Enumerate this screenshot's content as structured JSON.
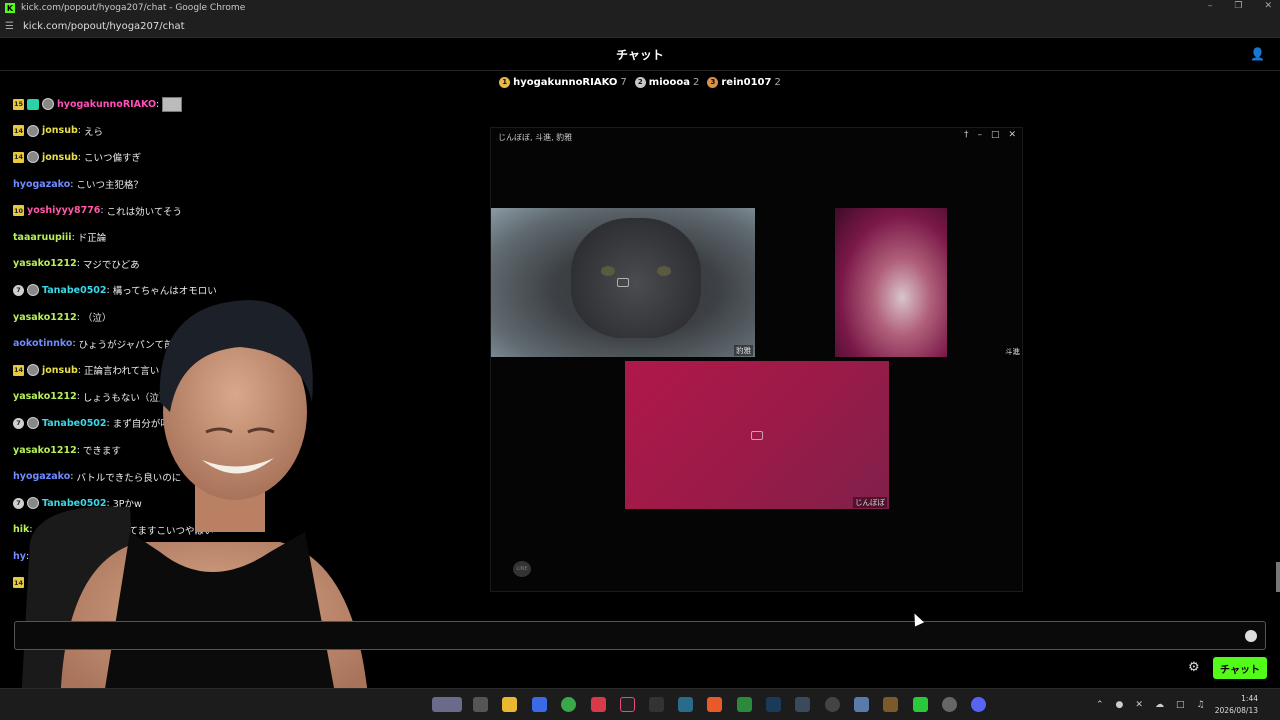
{
  "browser": {
    "window_title": "kick.com/popout/hyoga207/chat - Google Chrome",
    "url": "kick.com/popout/hyoga207/chat"
  },
  "chat": {
    "header_title": "チャット",
    "input_placeholder": "",
    "send_label": "チャット"
  },
  "leaderboard": [
    {
      "rank": "1",
      "name": "hyogakunnoRIAKO",
      "count": "7",
      "color": "#e8b84a"
    },
    {
      "rank": "2",
      "name": "mioooa",
      "count": "2",
      "color": "#c8c8c8"
    },
    {
      "rank": "3",
      "name": "rein0107",
      "count": "2",
      "color": "#d9924a"
    }
  ],
  "messages": [
    {
      "badge": "15",
      "badge_type": "sub",
      "extra": "tag",
      "avatar": true,
      "user": "hyogakunnoRIAKO",
      "color": "#ff4fb8",
      "text": "",
      "emote": true
    },
    {
      "badge": "14",
      "badge_type": "sub",
      "avatar": true,
      "user": "jonsub",
      "color": "#e8e04a",
      "text": "えら"
    },
    {
      "badge": "14",
      "badge_type": "sub",
      "avatar": true,
      "user": "jonsub",
      "color": "#e8e04a",
      "text": "こいつ偏すぎ"
    },
    {
      "badge": "",
      "user": "hyogazako",
      "color": "#6f8cff",
      "text": "こいつ主犯格？"
    },
    {
      "badge": "10",
      "badge_type": "sub",
      "user": "yoshiyyy8776",
      "color": "#ff5aa8",
      "text": "これは効いてそう"
    },
    {
      "badge": "",
      "user": "taaaruupiii",
      "color": "#b8f05a",
      "text": "ド正論"
    },
    {
      "badge": "",
      "user": "yasako1212",
      "color": "#b8f05a",
      "text": "マジでひどあ"
    },
    {
      "badge": "7",
      "badge_type": "gift",
      "avatar": true,
      "user": "Tanabe0502",
      "color": "#3ad8e8",
      "text": "構ってちゃんはオモロい"
    },
    {
      "badge": "",
      "user": "yasako1212",
      "color": "#b8f05a",
      "text": "（泣）"
    },
    {
      "badge": "",
      "user": "aokotinnko",
      "color": "#6f8cff",
      "text": "ひょうがジャパンて前"
    },
    {
      "badge": "14",
      "badge_type": "sub",
      "avatar": true,
      "user": "jonsub",
      "color": "#e8e04a",
      "text": "正論言われて言い"
    },
    {
      "badge": "",
      "user": "yasako1212",
      "color": "#b8f05a",
      "text": "しょうもない（泣）"
    },
    {
      "badge": "7",
      "badge_type": "gift",
      "avatar": true,
      "user": "Tanabe0502",
      "color": "#3ad8e8",
      "text": "まず自分が叩"
    },
    {
      "badge": "",
      "user": "yasako1212",
      "color": "#b8f05a",
      "text": "できます"
    },
    {
      "badge": "",
      "user": "hyogazako",
      "color": "#6f8cff",
      "text": "バトルできたら良いのに"
    },
    {
      "badge": "7",
      "badge_type": "gift",
      "avatar": true,
      "user": "Tanabe0502",
      "color": "#3ad8e8",
      "text": "3Pかw"
    },
    {
      "badge": "",
      "user": "hik",
      "color": "#b8f05a",
      "text": "ayのらdmで詰められてますこいつやばい"
    },
    {
      "badge": "",
      "user": "hy",
      "color": "#6f8cff",
      "text": ""
    },
    {
      "badge": "14",
      "badge_type": "sub",
      "user": "",
      "color": "#e8e04a",
      "text": ""
    }
  ],
  "call": {
    "title": "じんぼぼ, 斗進, 豹雅",
    "tiles": [
      {
        "label": "豹雅"
      },
      {
        "label": "斗進"
      },
      {
        "label": "じんぼぼ"
      }
    ],
    "logo": "LINE"
  },
  "taskbar": {
    "time": "1:44",
    "date": "2026/08/13"
  },
  "colors": {
    "accent": "#53fc18",
    "background": "#000000"
  }
}
